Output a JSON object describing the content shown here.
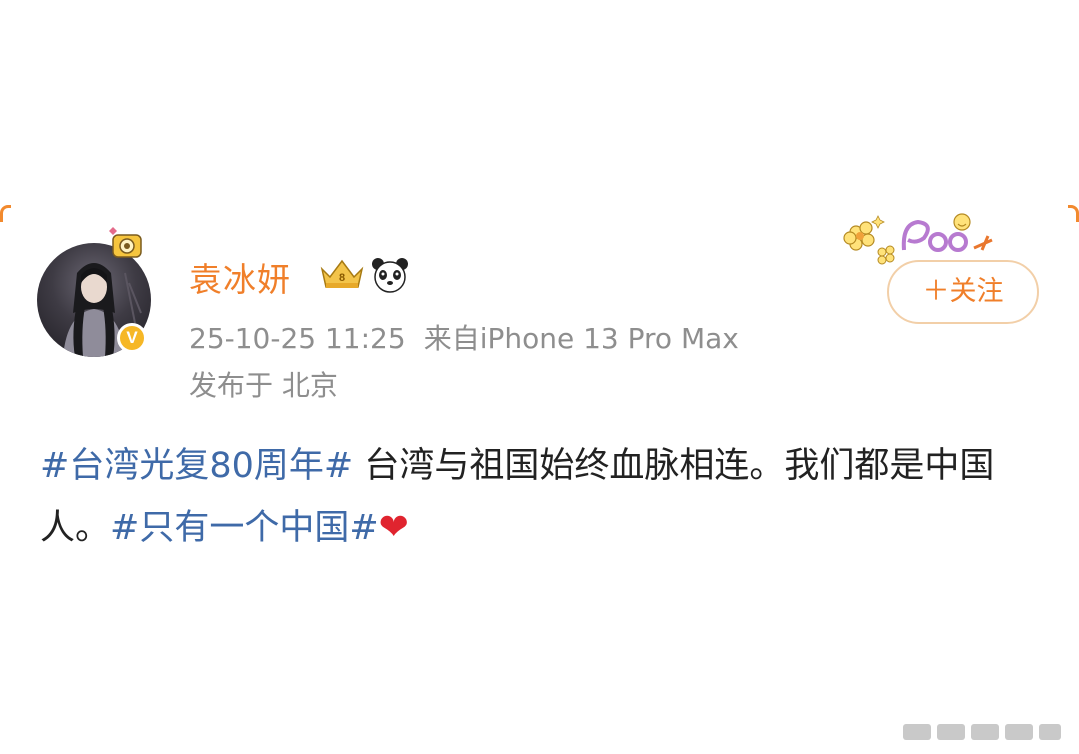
{
  "post": {
    "username": "袁冰妍",
    "timestamp": "25-10-25 11:25",
    "source": "来自iPhone 13 Pro Max",
    "location": "发布于 北京",
    "verified_badge": "V",
    "follow_label": "＋关注",
    "content": {
      "tag1": "#台湾光复80周年#",
      "text1": " 台湾与祖国始终血脉相连。我们都是中国人。",
      "tag2": "#只有一个中国#",
      "emoji": "❤"
    },
    "icons": [
      "camera-pendant-icon",
      "vip-crown-icon",
      "panda-icon",
      "flower-sticker-decoration",
      "verified-v-icon"
    ]
  },
  "colors": {
    "username": "#f07f2a",
    "meta": "#8e8e8e",
    "hashtag": "#3f6aa8",
    "text": "#222222",
    "follow_border": "#f2cfa8",
    "heart": "#e0242f",
    "verified": "#f6b726"
  }
}
